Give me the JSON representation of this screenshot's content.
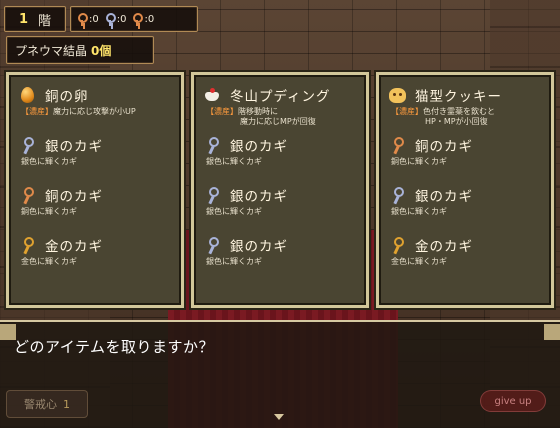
{
  "hud": {
    "floor_num": "1",
    "floor_label": "階",
    "keys": [
      {
        "type": "copper",
        "count": ":0",
        "color": "#e08a4a"
      },
      {
        "type": "silver",
        "count": ":0",
        "color": "#a9b3d8"
      },
      {
        "type": "copper",
        "count": ":0",
        "color": "#e08a4a"
      }
    ],
    "pneuma_label": "プネウマ結晶",
    "pneuma_count": "0個"
  },
  "panels": [
    {
      "items": [
        {
          "icon": "egg-icon",
          "name": "銅の卵",
          "tag": "【濃産】",
          "desc": "魔力に応じ攻撃が小UP",
          "desc2": ""
        },
        {
          "icon": "silver-key-icon",
          "name": "銀のカギ",
          "tag": "",
          "desc": "銀色に輝くカギ",
          "desc2": ""
        },
        {
          "icon": "copper-key-icon",
          "name": "銅のカギ",
          "tag": "",
          "desc": "銅色に輝くカギ",
          "desc2": ""
        },
        {
          "icon": "gold-key-icon",
          "name": "金のカギ",
          "tag": "",
          "desc": "金色に輝くカギ",
          "desc2": ""
        }
      ]
    },
    {
      "items": [
        {
          "icon": "pudding-icon",
          "name": "冬山プディング",
          "tag": "【濃産】",
          "desc": "階移動時に",
          "desc2": "魔力に応じMPが回復"
        },
        {
          "icon": "silver-key-icon",
          "name": "銀のカギ",
          "tag": "",
          "desc": "銀色に輝くカギ",
          "desc2": ""
        },
        {
          "icon": "silver-key-icon",
          "name": "銀のカギ",
          "tag": "",
          "desc": "銀色に輝くカギ",
          "desc2": ""
        },
        {
          "icon": "silver-key-icon",
          "name": "銀のカギ",
          "tag": "",
          "desc": "銀色に輝くカギ",
          "desc2": ""
        }
      ]
    },
    {
      "items": [
        {
          "icon": "cookie-icon",
          "name": "猫型クッキー",
          "tag": "【濃産】",
          "desc": "色付き霊薬を飲むと",
          "desc2": "HP・MPが小回復"
        },
        {
          "icon": "copper-key-icon",
          "name": "銅のカギ",
          "tag": "",
          "desc": "銅色に輝くカギ",
          "desc2": ""
        },
        {
          "icon": "silver-key-icon",
          "name": "銀のカギ",
          "tag": "",
          "desc": "銀色に輝くカギ",
          "desc2": ""
        },
        {
          "icon": "gold-key-icon",
          "name": "金のカギ",
          "tag": "",
          "desc": "金色に輝くカギ",
          "desc2": ""
        }
      ]
    }
  ],
  "message": "どのアイテムを取りますか？",
  "caution_label": "警戒心",
  "caution_value": "1",
  "give_up_label": "give up"
}
